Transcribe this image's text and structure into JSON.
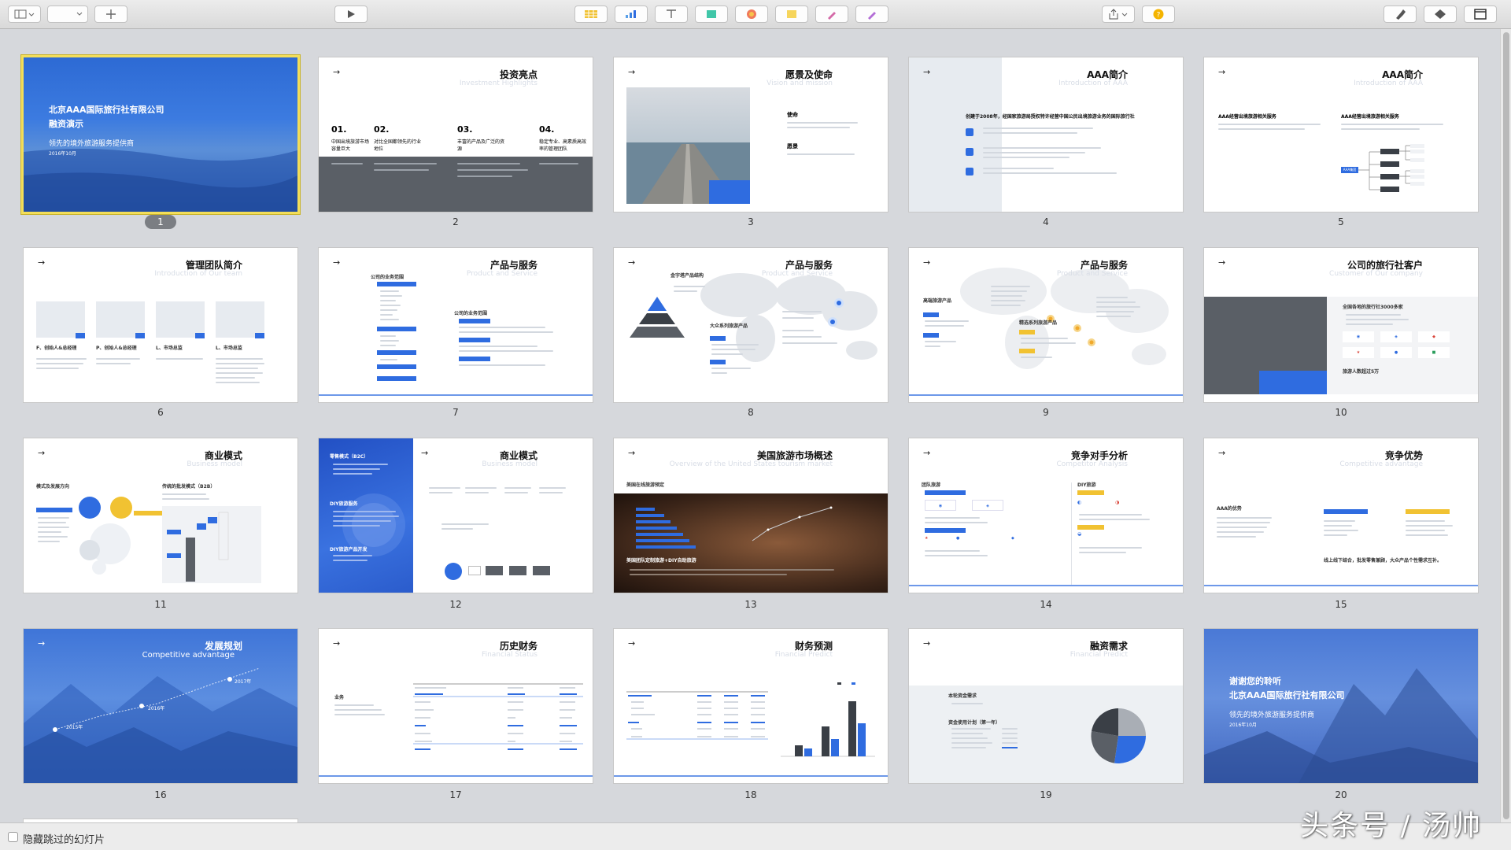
{
  "toolbar": {
    "view_icon": "sidebar-view-icon",
    "play_icon": "play-icon"
  },
  "slides": [
    {
      "num": "1",
      "title": "北京AAA国际旅行社有限公司",
      "line2": "融资演示",
      "line3": "领先的境外旅游服务提供商",
      "date": "2016年10月"
    },
    {
      "num": "2",
      "title": "投资亮点",
      "subtitle": "Investment Highlights",
      "items": [
        {
          "n": "01.",
          "t": "中国出境旅游市场容量巨大"
        },
        {
          "n": "02.",
          "t": "对比全国都领先的行业地位"
        },
        {
          "n": "03.",
          "t": "丰富的产品及广泛的资源"
        },
        {
          "n": "04.",
          "t": "稳定专业、高素质高效率的管理团队"
        }
      ]
    },
    {
      "num": "3",
      "title": "愿景及使命",
      "subtitle": "Vision and mission",
      "label1": "使命",
      "label2": "愿景"
    },
    {
      "num": "4",
      "title": "AAA简介",
      "subtitle": "Introduction of AAA",
      "headline": "创建于2008年，经国家旅游局授权特许经营中国公民出境旅游业务的国际旅行社"
    },
    {
      "num": "5",
      "title": "AAA简介",
      "subtitle": "Introduction of AAA",
      "headline": "AAA经营出境旅游相关服务",
      "node": "AAA集团"
    },
    {
      "num": "6",
      "title": "管理团队简介",
      "subtitle": "Introduction of Our team",
      "members": [
        "F、创始人&总经理",
        "P、创始人&总经理",
        "L、市场总监",
        "L、市场总监"
      ]
    },
    {
      "num": "7",
      "title": "产品与服务",
      "subtitle": "Product and Service",
      "left": "公司的业务范围",
      "right": "公司的业务范围"
    },
    {
      "num": "8",
      "title": "产品与服务",
      "subtitle": "Product and Service",
      "left": "金字塔产品结构",
      "mid": "大众系列旅游产品"
    },
    {
      "num": "9",
      "title": "产品与服务",
      "subtitle": "Product and Service",
      "left": "高端旅游产品",
      "mid": "精选系列旅游产品"
    },
    {
      "num": "10",
      "title": "公司的旅行社客户",
      "subtitle": "Customer of Our company",
      "headline": "全国各地的旅行社3000多家",
      "footer": "旅游人数超过5万"
    },
    {
      "num": "11",
      "title": "商业模式",
      "subtitle": "Business model",
      "left": "模式及发展方向",
      "right": "传统的批发模式（B2B）"
    },
    {
      "num": "12",
      "title": "商业模式",
      "subtitle": "Business model",
      "left1": "零售模式（B2C）",
      "left2": "DIY旅游服务",
      "left3": "DIY旅游产品开发"
    },
    {
      "num": "13",
      "title": "美国旅游市场概述",
      "subtitle": "Overview of the United States tourism market",
      "label1": "美国在线旅游预定",
      "label2": "美国团队定制旅游+DIY自助旅游"
    },
    {
      "num": "14",
      "title": "竞争对手分析",
      "subtitle": "Competitor Analysis",
      "left": "团队旅游",
      "right": "DIY旅游"
    },
    {
      "num": "15",
      "title": "竞争优势",
      "subtitle": "Competitive advantage",
      "left": "AAA的优势",
      "tagline": "线上线下结合，批发零售兼顾，大众产品个性需求互补。"
    },
    {
      "num": "16",
      "title": "发展规划",
      "subtitle": "Competitive advantage",
      "y1": "2015年",
      "y2": "2016年",
      "y3": "2017年"
    },
    {
      "num": "17",
      "title": "历史财务",
      "subtitle": "Financial Status",
      "left": "业务"
    },
    {
      "num": "18",
      "title": "财务预测",
      "subtitle": "Financial Predict"
    },
    {
      "num": "19",
      "title": "融资需求",
      "subtitle": "Financial Predict",
      "left1": "本轮资金需求",
      "left2": "资金使用计划（第一年）"
    },
    {
      "num": "20",
      "title": "谢谢您的聆听",
      "line2": "北京AAA国际旅行社有限公司",
      "line3": "领先的境外旅游服务提供商",
      "date": "2016年10月"
    }
  ],
  "footer": {
    "hide_skipped_label": "隐藏跳过的幻灯片"
  },
  "watermark": "头条号 / 汤帅",
  "colors": {
    "accent": "#2f6ce0",
    "selection": "#f3de5a"
  }
}
